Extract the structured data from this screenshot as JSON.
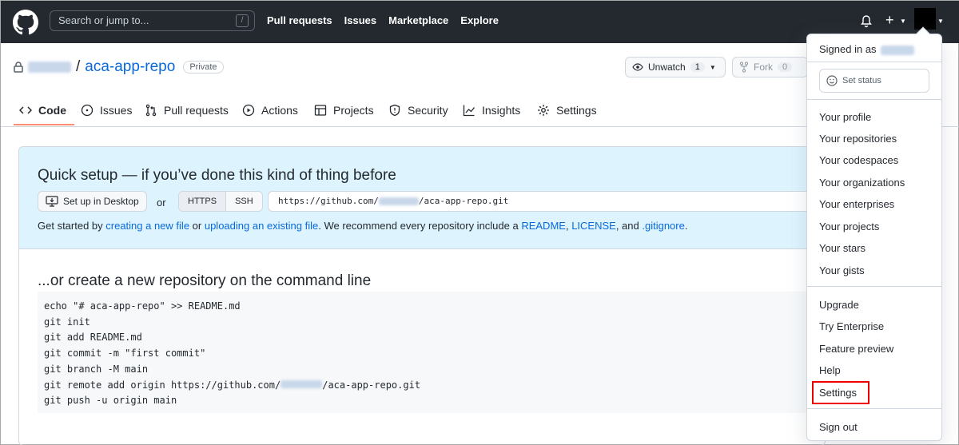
{
  "header": {
    "search_placeholder": "Search or jump to...",
    "search_key": "/",
    "nav": [
      "Pull requests",
      "Issues",
      "Marketplace",
      "Explore"
    ]
  },
  "repo": {
    "separator": "/",
    "name": "aca-app-repo",
    "visibility": "Private",
    "watch_label": "Unwatch",
    "watch_count": "1",
    "fork_label": "Fork",
    "fork_count": "0"
  },
  "tabs": [
    {
      "label": "Code",
      "icon": "code-icon"
    },
    {
      "label": "Issues",
      "icon": "issue-icon"
    },
    {
      "label": "Pull requests",
      "icon": "pull-request-icon"
    },
    {
      "label": "Actions",
      "icon": "play-icon"
    },
    {
      "label": "Projects",
      "icon": "table-icon"
    },
    {
      "label": "Security",
      "icon": "shield-icon"
    },
    {
      "label": "Insights",
      "icon": "graph-icon"
    },
    {
      "label": "Settings",
      "icon": "gear-icon"
    }
  ],
  "quick_setup": {
    "title": "Quick setup — if you’ve done this kind of thing before",
    "desktop_button": "Set up in Desktop",
    "or": "or",
    "https": "HTTPS",
    "ssh": "SSH",
    "url_prefix": "https://github.com/",
    "url_suffix": "/aca-app-repo.git",
    "started": {
      "t1": "Get started by ",
      "l1": "creating a new file",
      "t2": " or ",
      "l2": "uploading an existing file",
      "t3": ". We recommend every repository include a ",
      "l3": "README",
      "t4": ", ",
      "l4": "LICENSE",
      "t5": ", and ",
      "l5": ".gitignore",
      "t6": "."
    }
  },
  "command_line": {
    "title": "...or create a new repository on the command line",
    "lines": [
      "echo \"# aca-app-repo\" >> README.md",
      "git init",
      "git add README.md",
      "git commit -m \"first commit\"",
      "git branch -M main",
      "git remote add origin https://github.com/",
      "git push -u origin main"
    ],
    "remote_suffix": "/aca-app-repo.git"
  },
  "menu": {
    "signed_in": "Signed in as",
    "set_status": "Set status",
    "group1": [
      "Your profile",
      "Your repositories",
      "Your codespaces",
      "Your organizations",
      "Your enterprises",
      "Your projects",
      "Your stars",
      "Your gists"
    ],
    "group2": [
      "Upgrade",
      "Try Enterprise",
      "Feature preview",
      "Help",
      "Settings"
    ],
    "sign_out": "Sign out"
  },
  "colors": {
    "header_bg": "#24292f",
    "link": "#0969da",
    "quick_setup_bg": "#ddf4ff",
    "highlight": "#e00000"
  }
}
